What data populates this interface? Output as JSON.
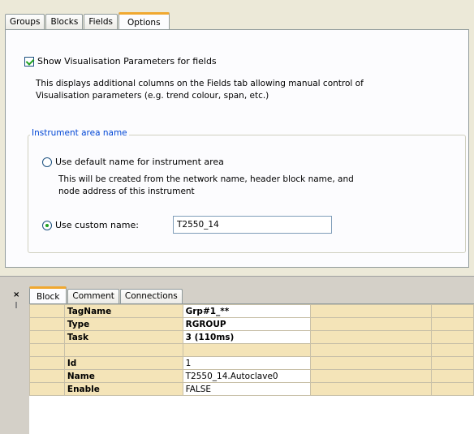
{
  "tabs": [
    "Groups",
    "Blocks",
    "Fields",
    "Options"
  ],
  "active_tab": "Options",
  "options": {
    "checkbox_label": "Show Visualisation Parameters for fields",
    "checkbox_checked": true,
    "checkbox_desc_1": "This displays additional columns on the Fields tab allowing manual control of",
    "checkbox_desc_2": "Visualisation parameters (e.g. trend colour, span, etc.)",
    "group_title": "Instrument area name",
    "radio_default_label": "Use default name for instrument area",
    "radio_default_desc_1": "This will be created from the network name, header block name, and",
    "radio_default_desc_2": "node address of this instrument",
    "radio_custom_label": "Use custom name:",
    "custom_name_value": "T2550_14",
    "selected_radio": "custom"
  },
  "bottom": {
    "pin_symbol": "×",
    "tabs": [
      "Block",
      "Comment",
      "Connections"
    ],
    "active_tab": "Block",
    "rows": [
      {
        "name": "TagName",
        "value": "Grp#1_**",
        "value_bold": true
      },
      {
        "name": "Type",
        "value": "RGROUP",
        "value_bold": true
      },
      {
        "name": "Task",
        "value": "3 (110ms)",
        "value_bold": true
      },
      {
        "name": "",
        "value": "",
        "value_bold": false
      },
      {
        "name": "Id",
        "value": "1",
        "value_bold": false
      },
      {
        "name": "Name",
        "value": "T2550_14.Autoclave0",
        "value_bold": false
      },
      {
        "name": "Enable",
        "value": "FALSE",
        "value_bold": false
      }
    ]
  },
  "colors": {
    "accent_tab": "#f0a830",
    "group_title": "#0046d5",
    "grid_header": "#f4e4b8"
  }
}
